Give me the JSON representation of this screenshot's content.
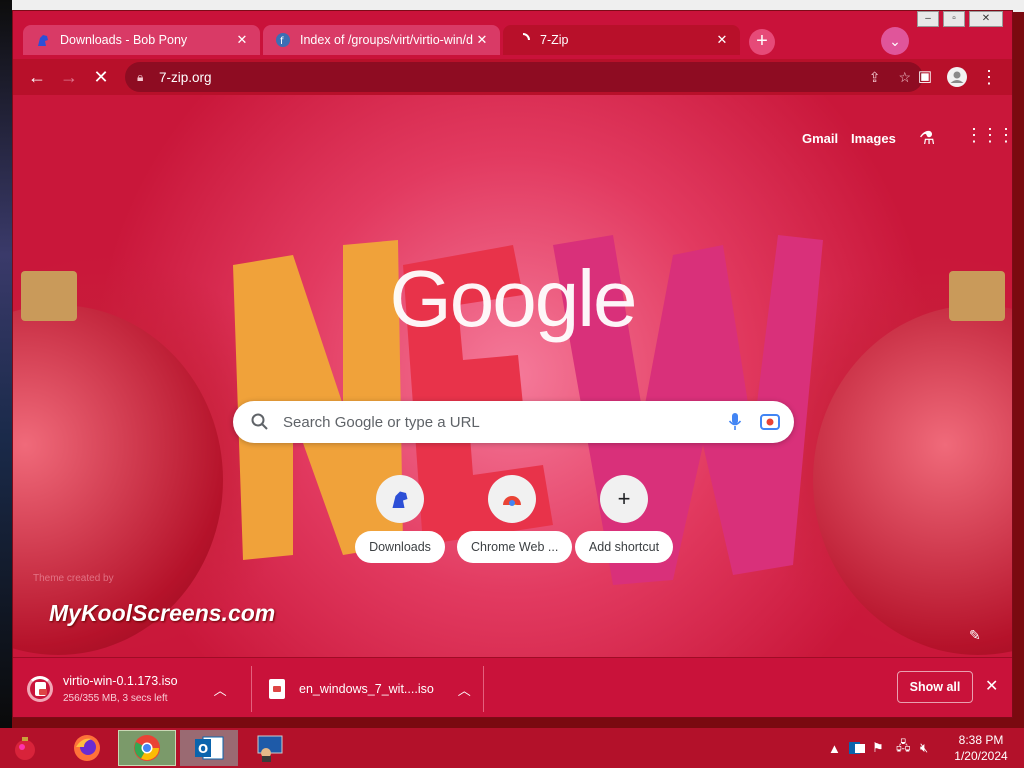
{
  "tabs": [
    {
      "title": "Downloads - Bob Pony",
      "state": "inactive",
      "icon": "bob-pony-favicon"
    },
    {
      "title": "Index of /groups/virt/virtio-win/d",
      "state": "inactive",
      "icon": "fedora-favicon"
    },
    {
      "title": "7-Zip",
      "state": "active-loading",
      "icon": "loading-favicon"
    }
  ],
  "toolbar": {
    "url": "7-zip.org"
  },
  "ntp": {
    "links": {
      "gmail": "Gmail",
      "images": "Images"
    },
    "logo_text": "Google",
    "search_placeholder": "Search Google or type a URL",
    "shortcuts": [
      {
        "label": "Downloads",
        "icon": "bob-pony-icon"
      },
      {
        "label": "Chrome Web ...",
        "icon": "chrome-web-store-icon"
      },
      {
        "label": "Add shortcut",
        "icon": "plus-icon"
      }
    ],
    "watermark": "MyKoolScreens.com",
    "theme_credit": "Theme created by"
  },
  "downloads": [
    {
      "name": "virtio-win-0.1.173.iso",
      "status": "256/355 MB, 3 secs left",
      "progress": 0.72
    },
    {
      "name": "en_windows_7_wit....iso",
      "status": ""
    }
  ],
  "download_bar": {
    "show_all": "Show all"
  },
  "taskbar": {
    "items": [
      "christmas-ornament-start",
      "firefox",
      "chrome",
      "outlook",
      "remote-desktop"
    ],
    "clock_time": "8:38 PM",
    "clock_date": "1/20/2024"
  },
  "colors": {
    "accent": "#b8102a",
    "tabstrip": "#c9123a",
    "inactive_tab": "#d93a66"
  }
}
